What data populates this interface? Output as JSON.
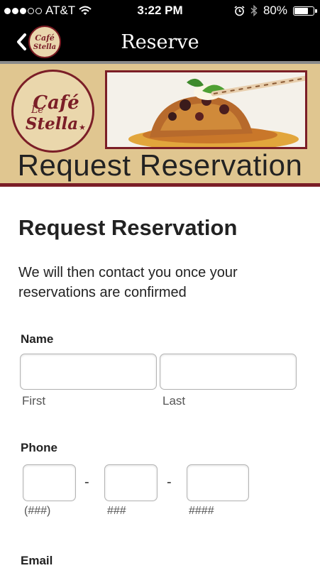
{
  "status_bar": {
    "carrier": "AT&T",
    "time": "3:22 PM",
    "battery": "80%",
    "battery_level": 0.8,
    "signal_bars_filled": 3,
    "signal_bars_total": 5
  },
  "nav": {
    "title": "Reserve",
    "back_logo_text": "Le Café Stella"
  },
  "banner": {
    "logo_text": "Le Café Stella ★",
    "title": "Request Reservation",
    "colors": {
      "accent": "#7b1e27",
      "background": "#e0c690"
    }
  },
  "form": {
    "heading": "Request Reservation",
    "intro": "We will then contact you once your reservations are confirmed",
    "name": {
      "label": "Name",
      "first_sublabel": "First",
      "last_sublabel": "Last"
    },
    "phone": {
      "label": "Phone",
      "separator": "-",
      "area_hint": "(###)",
      "prefix_hint": "###",
      "line_hint": "####"
    },
    "email": {
      "label": "Email"
    }
  }
}
